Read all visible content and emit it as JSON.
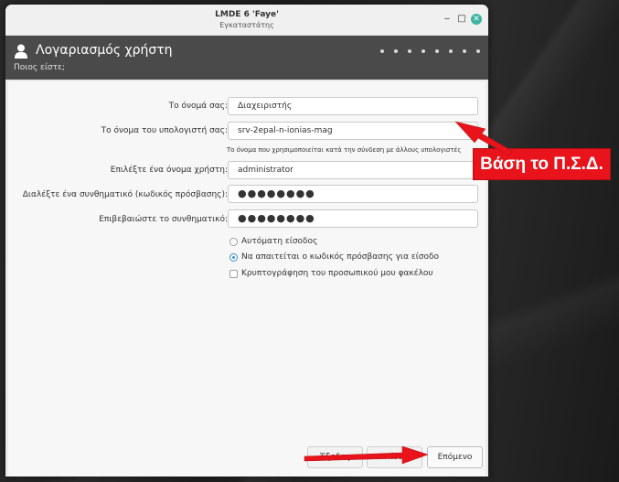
{
  "window": {
    "title": "LMDE 6 'Faye'",
    "subtitle": "Εγκαταστάτης",
    "controls": {
      "minimize": "‒",
      "maximize": "□",
      "close": "✕"
    }
  },
  "header": {
    "title": "Λογαριασμός χρήστη",
    "subtitle": "Ποιος είστε;",
    "step_count": 8
  },
  "form": {
    "name_label": "Το όνομά σας:",
    "name_value": "Διαχειριστής",
    "hostname_label": "Το όνομα του υπολογιστή σας:",
    "hostname_value": "srv-2epal-n-ionias-mag",
    "hostname_hint": "Το όνομα που χρησιμοποιείται κατά την σύνδεση με άλλους υπολογιστές",
    "username_label": "Επιλέξτε ένα όνομα χρήστη:",
    "username_value": "administrator",
    "password_label": "Διαλέξτε ένα συνθηματικό (κωδικός πρόσβασης):",
    "password_value": "●●●●●●●●",
    "confirm_label": "Επιβεβαιώστε το συνθηματικό:",
    "confirm_value": "●●●●●●●●"
  },
  "options": {
    "autologin": "Αυτόματη είσοδος",
    "require_password": "Να απαιτείται ο κωδικός πρόσβασης για είσοδο",
    "encrypt_home": "Κρυπτογράφηση του προσωπικού μου φακέλου",
    "selected": "require_password"
  },
  "buttons": {
    "quit": "Έξοδος",
    "back": "Πίσω",
    "next": "Επόμενο"
  },
  "annotation": {
    "text": "Βάση το Π.Σ.Δ.",
    "color": "#e8131b"
  }
}
